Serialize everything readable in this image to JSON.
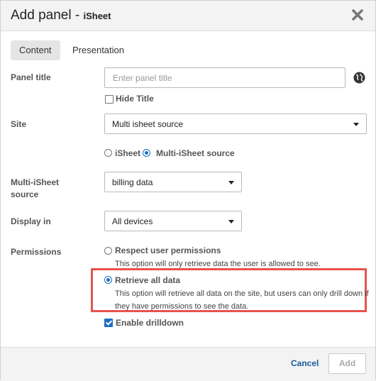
{
  "dialog": {
    "title": "Add panel",
    "title_separator": " - ",
    "subtitle": "iSheet",
    "close_icon": "close-icon"
  },
  "tabs": [
    {
      "label": "Content",
      "active": true
    },
    {
      "label": "Presentation",
      "active": false
    }
  ],
  "panel_title": {
    "label": "Panel title",
    "placeholder": "Enter panel title",
    "value": "",
    "language_icon": "globe-icon",
    "hide_title_label": "Hide Title",
    "hide_title_checked": false
  },
  "site": {
    "label": "Site",
    "selected": "Multi isheet source",
    "source_options": [
      {
        "label": "iSheet",
        "selected": false
      },
      {
        "label": "Multi-iSheet source",
        "selected": true
      }
    ]
  },
  "multi_source": {
    "label": "Multi-iSheet source",
    "selected": "billing data"
  },
  "display_in": {
    "label": "Display in",
    "selected": "All devices"
  },
  "permissions": {
    "label": "Permissions",
    "options": [
      {
        "label": "Respect user permissions",
        "description": "This option will only retrieve data the user is allowed to see.",
        "selected": false
      },
      {
        "label": "Retrieve all data",
        "description_line1": "This option will retrieve all data on the site, but users can only drill down if",
        "description_line2": "they have permissions to see the data.",
        "selected": true
      }
    ],
    "enable_drilldown_label": "Enable drilldown",
    "enable_drilldown_checked": true,
    "highlight_color": "#e8534a"
  },
  "footer": {
    "cancel_label": "Cancel",
    "add_label": "Add"
  },
  "colors": {
    "accent": "#1b6ec2",
    "header_bg": "#f3f3f3",
    "highlight": "#e8534a"
  }
}
